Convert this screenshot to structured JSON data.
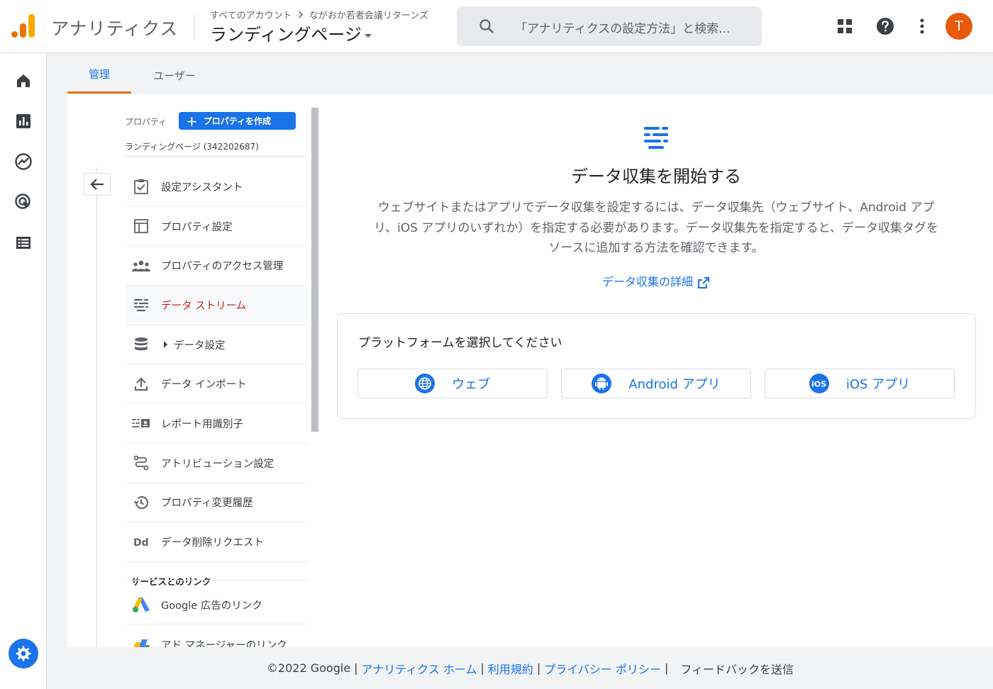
{
  "header": {
    "app_title": "アナリティクス",
    "breadcrumb_account": "すべてのアカウント",
    "breadcrumb_sep": ">",
    "breadcrumb_property": "ながおか若者会議リターンズ",
    "property_selector": "ランディングページ",
    "search_placeholder": "「アナリティクスの設定方法」と検索...",
    "avatar_initial": "T"
  },
  "tabs": [
    {
      "label": "管理",
      "active": true
    },
    {
      "label": "ユーザー",
      "active": false
    }
  ],
  "property_panel": {
    "label": "プロパティ",
    "create_button": "プロパティを作成",
    "property_name": "ランディングページ (342202687)"
  },
  "menu": [
    {
      "label": "設定アシスタント",
      "icon": "checklist-icon"
    },
    {
      "label": "プロパティ設定",
      "icon": "layout-icon"
    },
    {
      "label": "プロパティのアクセス管理",
      "icon": "people-icon"
    },
    {
      "label": "データ ストリーム",
      "icon": "data-stream-icon",
      "active": true
    },
    {
      "label": "データ設定",
      "icon": "database-icon",
      "expandable": true
    },
    {
      "label": "データ インポート",
      "icon": "upload-icon"
    },
    {
      "label": "レポート用識別子",
      "icon": "identity-icon"
    },
    {
      "label": "アトリビューション設定",
      "icon": "route-icon"
    },
    {
      "label": "プロパティ変更履歴",
      "icon": "history-icon"
    },
    {
      "label": "データ削除リクエスト",
      "icon": "dd-icon"
    }
  ],
  "links_section": {
    "title": "サービスとのリンク",
    "items": [
      {
        "label": "Google 広告のリンク",
        "icon": "google-ads-icon"
      },
      {
        "label": "アド マネージャーのリンク",
        "icon": "ad-manager-icon"
      }
    ]
  },
  "main": {
    "title": "データ収集を開始する",
    "description": "ウェブサイトまたはアプリでデータ収集を設定するには、データ収集先（ウェブサイト、Android アプリ、iOS アプリのいずれか）を指定する必要があります。データ収集先を指定すると、データ収集タグをソースに追加する方法を確認できます。",
    "detail_link": "データ収集の詳細",
    "platform_title": "プラットフォームを選択してください",
    "platforms": [
      {
        "label": "ウェブ",
        "icon": "globe-icon"
      },
      {
        "label": "Android アプリ",
        "icon": "android-icon"
      },
      {
        "label": "iOS アプリ",
        "icon": "ios-icon"
      }
    ]
  },
  "footer": {
    "copyright": "©2022 Google",
    "links": [
      "アナリティクス ホーム",
      "利用規約",
      "プライバシー ポリシー"
    ],
    "separator": "|",
    "feedback": "フィードバックを送信"
  },
  "colors": {
    "accent_blue": "#1a73e8",
    "active_red": "#c5221f",
    "tab_underline_orange": "#e8710a",
    "avatar_orange": "#e8590c",
    "logo_orange": "#f9ab00",
    "logo_dark_orange": "#e37400"
  }
}
